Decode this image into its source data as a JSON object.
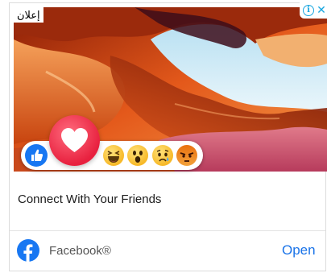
{
  "ad": {
    "sponsored_label": "إعلان",
    "title": "Connect With Your Friends",
    "advertiser": "Facebook®",
    "cta_label": "Open",
    "info_glyph": "i",
    "close_glyph": "✕"
  },
  "reactions": [
    "like-icon",
    "love-icon",
    "haha-icon",
    "wow-icon",
    "sad-icon",
    "angry-icon"
  ],
  "colors": {
    "facebook_blue": "#1877f2",
    "love_red": "#e8213f",
    "emoji_yellow": "#f7b928",
    "angry_orange": "#e9710f",
    "cta_blue": "#1a73e8",
    "adchoices_blue": "#19a7e0"
  }
}
